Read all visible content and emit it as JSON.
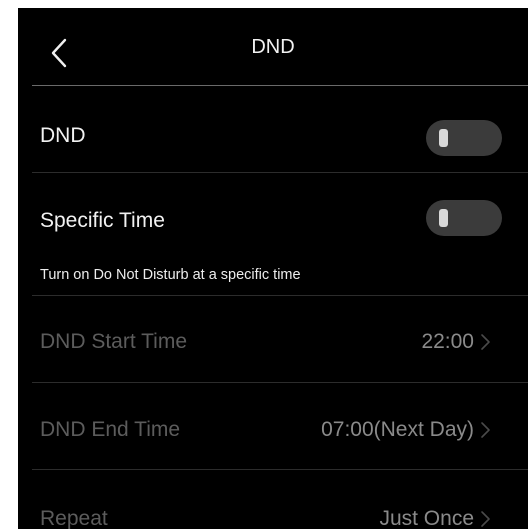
{
  "header": {
    "title": "DND"
  },
  "settings": {
    "dnd": {
      "label": "DND"
    },
    "specific_time": {
      "label": "Specific Time",
      "hint": "Turn on Do Not Disturb at a specific time"
    },
    "start_time": {
      "label": "DND Start Time",
      "value": "22:00"
    },
    "end_time": {
      "label": "DND End Time",
      "value": "07:00(Next Day)"
    },
    "repeat": {
      "label": "Repeat",
      "value": "Just Once"
    }
  }
}
